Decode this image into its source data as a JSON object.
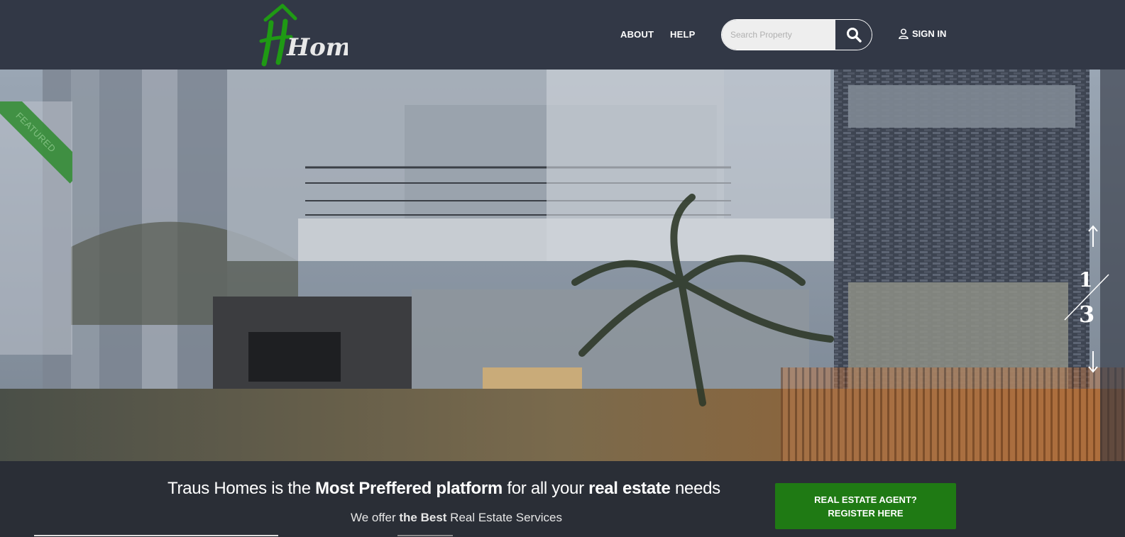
{
  "brand": {
    "logo_text": "Homes",
    "logo_accent": "#1f9a14"
  },
  "nav": {
    "about": "ABOUT",
    "help": "HELP",
    "signin": "SIGN IN"
  },
  "search": {
    "placeholder": "Search Property",
    "icon": "search-icon"
  },
  "hero": {
    "featured_label": "FEATURED",
    "slide_current": "1",
    "slide_total": "3",
    "up_icon": "arrow-up-icon",
    "down_icon": "arrow-down-icon"
  },
  "tagline": {
    "part1": "Traus Homes is the ",
    "bold1": "Most Preffered platform",
    "part2": " for all your ",
    "bold2": "real estate",
    "part3": " needs"
  },
  "subtagline": {
    "part1": "We offer ",
    "bold": "the Best",
    "part2": " Real Estate Services"
  },
  "cta": {
    "register": "REAL ESTATE AGENT? REGISTER HERE"
  },
  "colors": {
    "header_bg": "#323846",
    "band_bg": "#2a2e36",
    "cta_bg": "#1f7a14",
    "ribbon": "#2e8b2e"
  }
}
